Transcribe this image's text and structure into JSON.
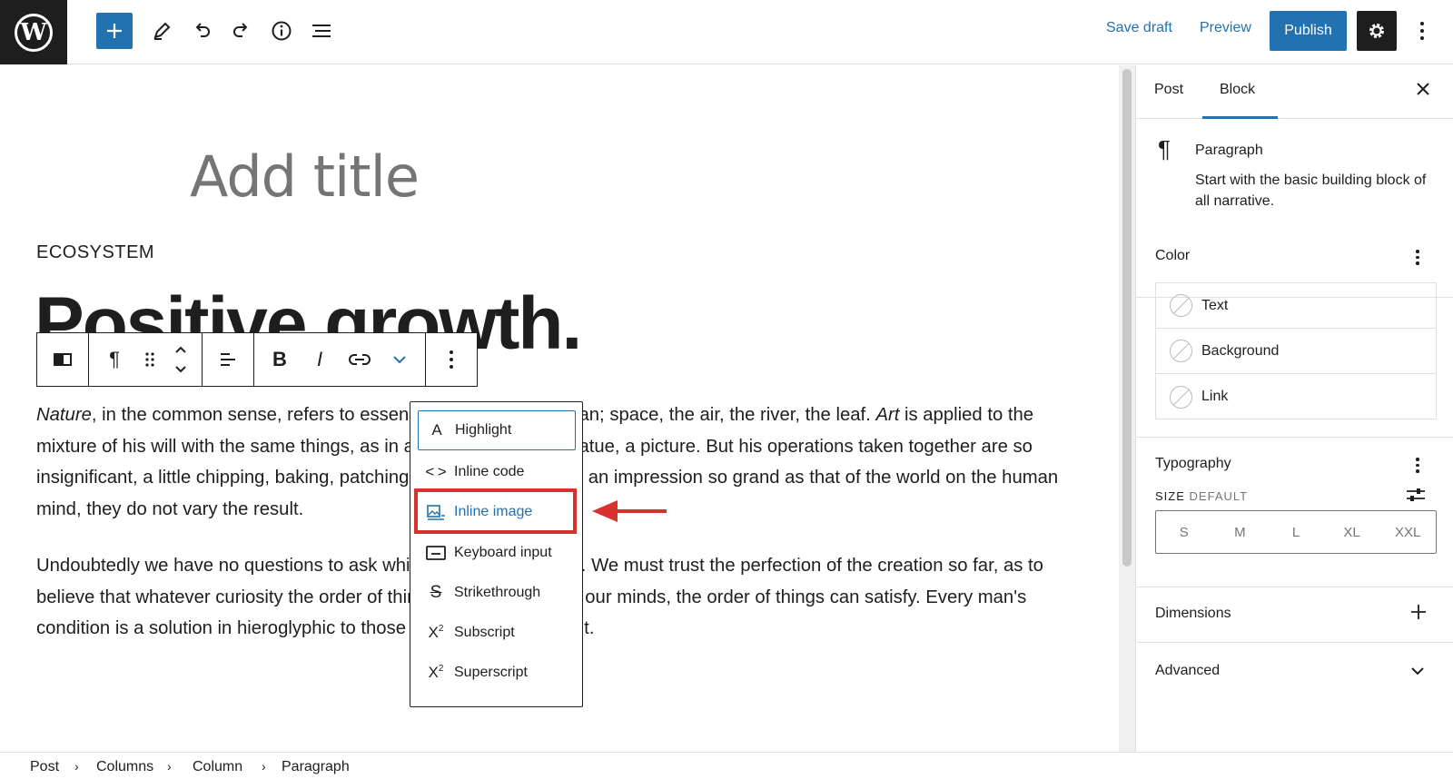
{
  "topbar": {
    "save_draft": "Save draft",
    "preview": "Preview",
    "publish": "Publish"
  },
  "editor": {
    "title_placeholder": "Add title",
    "eyebrow": "ECOSYSTEM",
    "heading": "Positive growth.",
    "paragraph1": {
      "lead_italic": "Nature",
      "text1": ", in the common sense, refers to essences unchanged by man; space, the air, the river, the leaf. ",
      "mid_italic": "Art",
      "text2": " is applied to the mixture of his will with the same things, as in a house, a canal, a statue, a picture. But his operations taken together are so insignificant, a little chipping, baking, patching, and washing, that in an impression so grand as that of the world on the human mind, they do not vary the result."
    },
    "paragraph2": "Undoubtedly we have no questions to ask which are unanswerable. We must trust the perfection of the creation so far, as to believe that whatever curiosity the order of things has awakened in our minds, the order of things can satisfy. Every man's condition is a solution in hieroglyphic to those inquiries he would put."
  },
  "format_menu": {
    "items": [
      {
        "label": "Highlight",
        "icon": "highlight-icon"
      },
      {
        "label": "Inline code",
        "icon": "code-icon"
      },
      {
        "label": "Inline image",
        "icon": "image-icon"
      },
      {
        "label": "Keyboard input",
        "icon": "keyboard-icon"
      },
      {
        "label": "Strikethrough",
        "icon": "strikethrough-icon"
      },
      {
        "label": "Subscript",
        "icon": "subscript-icon"
      },
      {
        "label": "Superscript",
        "icon": "superscript-icon"
      }
    ],
    "focused_item": "Highlight",
    "selected_item": "Inline image"
  },
  "sidebar": {
    "tabs": [
      "Post",
      "Block"
    ],
    "active_tab": "Block",
    "block_card": {
      "title": "Paragraph",
      "description": "Start with the basic building block of all narrative."
    },
    "color": {
      "title": "Color",
      "items": [
        "Text",
        "Background",
        "Link"
      ]
    },
    "typography": {
      "title": "Typography",
      "size_label": "SIZE",
      "size_value": "DEFAULT",
      "sizes": [
        "S",
        "M",
        "L",
        "XL",
        "XXL"
      ]
    },
    "dimensions": "Dimensions",
    "advanced": "Advanced"
  },
  "breadcrumb": [
    "Post",
    "Columns",
    "Column",
    "Paragraph"
  ],
  "colors": {
    "accent": "#2271b1",
    "annotation": "#d93030",
    "dark": "#1e1e1e"
  }
}
